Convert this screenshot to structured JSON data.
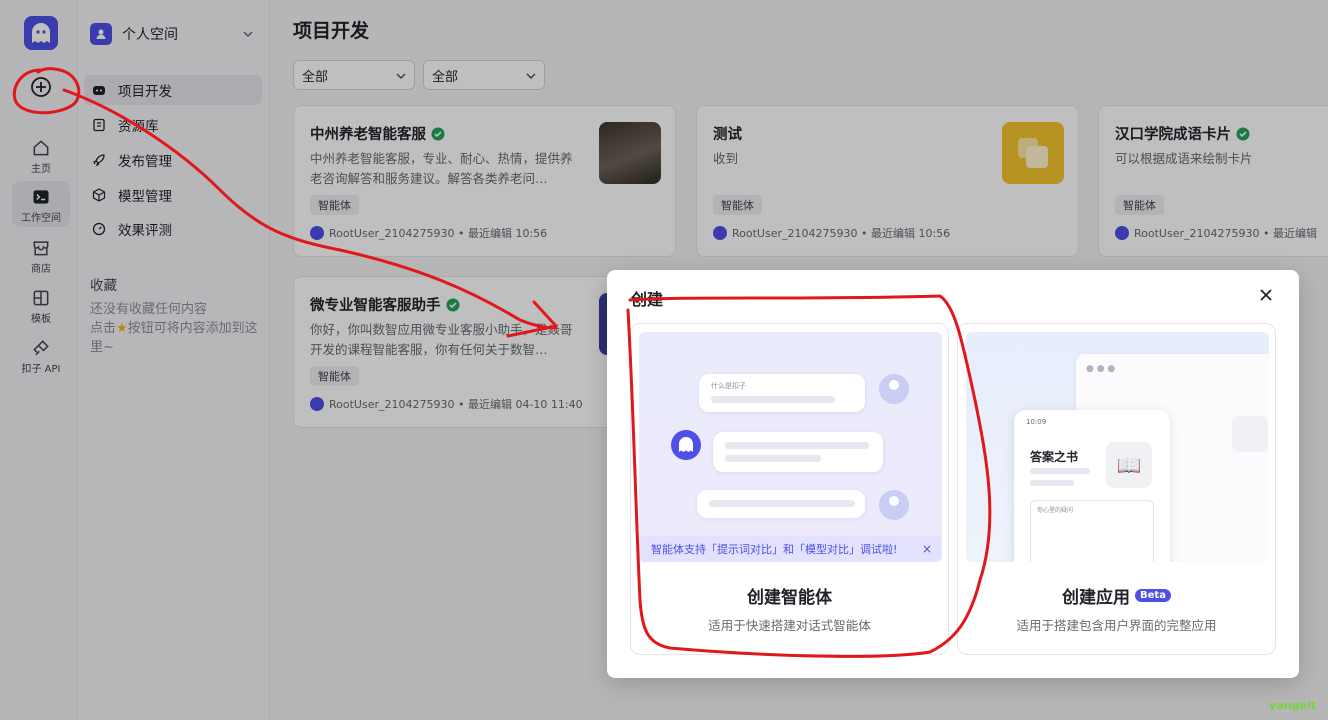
{
  "rail": {
    "items": [
      {
        "label": "主页"
      },
      {
        "label": "工作空间"
      },
      {
        "label": "商店"
      },
      {
        "label": "模板"
      },
      {
        "label": "扣子 API"
      }
    ]
  },
  "sidebar": {
    "space_name": "个人空间",
    "nav": [
      {
        "label": "项目开发"
      },
      {
        "label": "资源库"
      },
      {
        "label": "发布管理"
      },
      {
        "label": "模型管理"
      },
      {
        "label": "效果评测"
      }
    ],
    "favorites_title": "收藏",
    "favorites_empty_1": "还没有收藏任何内容",
    "favorites_empty_2_pre": "点击",
    "favorites_empty_2_post": "按钮可将内容添加到这里~"
  },
  "main": {
    "title": "项目开发",
    "filters": [
      "全部",
      "全部"
    ],
    "cards": [
      {
        "name": "中州养老智能客服",
        "desc": "中州养老智能客服，专业、耐心、热情，提供养老咨询解答和服务建议。解答各类养老问…",
        "tag": "智能体",
        "meta": "RootUser_2104275930 • 最近编辑 10:56"
      },
      {
        "name": "测试",
        "desc": "收到",
        "tag": "智能体",
        "meta": "RootUser_2104275930 • 最近编辑 10:56"
      },
      {
        "name": "汉口学院成语卡片",
        "desc": "可以根据成语来绘制卡片",
        "tag": "智能体",
        "meta": "RootUser_2104275930 • 最近编辑"
      },
      {
        "name": "微专业智能客服助手",
        "desc": "你好，你叫数智应用微专业客服小助手，是焱哥开发的课程智能客服，你有任何关于数智…",
        "tag": "智能体",
        "meta": "RootUser_2104275930 • 最近编辑 04-10 11:40"
      }
    ]
  },
  "modal": {
    "title": "创建",
    "agent": {
      "title": "创建智能体",
      "desc": "适用于快速搭建对话式智能体",
      "bubble_text": "什么是扣子",
      "banner": "智能体支持「提示词对比」和「模型对比」调试啦!"
    },
    "app": {
      "title": "创建应用",
      "beta": "Beta",
      "desc": "适用于搭建包含用户界面的完整应用",
      "book_title": "答案之书",
      "phone_time": "10:09",
      "phone_input": "你心里的疑问"
    }
  },
  "watermark": "yangeit",
  "colors": {
    "accent": "#4e4fe6",
    "annotation": "#e0181b",
    "verified": "#22a35a"
  }
}
